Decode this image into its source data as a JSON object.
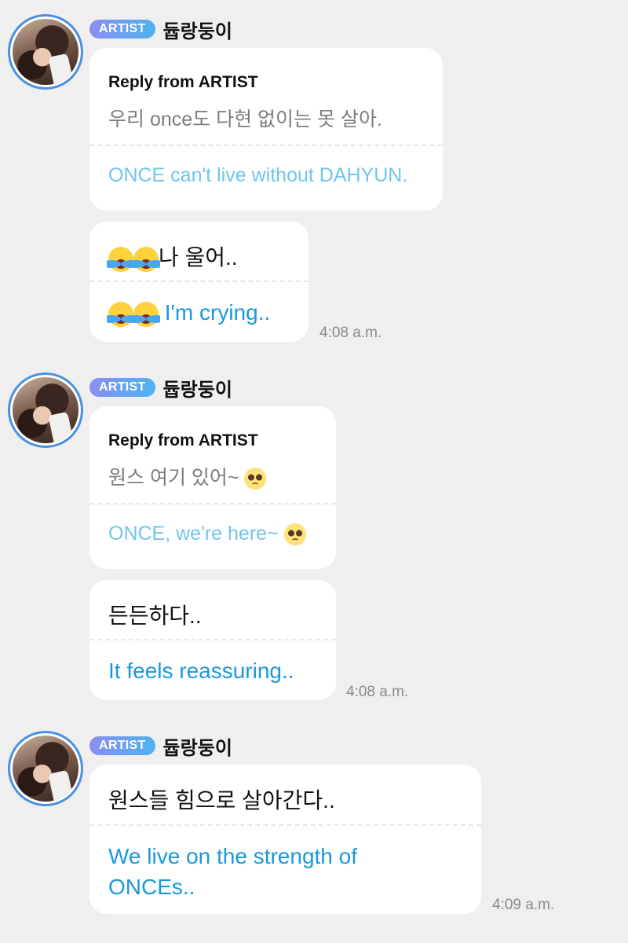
{
  "messages": [
    {
      "badge": "ARTIST",
      "name": "듑랑둥이",
      "reply_label": "Reply from ARTIST",
      "reply_ko": "우리 once도 다현 없이는 못 살아.",
      "reply_en": "ONCE can't live without DAHYUN.",
      "followup_ko": "나 울어..",
      "followup_en": " I'm crying..",
      "time": "4:08 a.m."
    },
    {
      "badge": "ARTIST",
      "name": "듑랑둥이",
      "reply_label": "Reply from ARTIST",
      "reply_ko": "원스 여기 있어~ ",
      "reply_en": "ONCE, we're here~ ",
      "followup_ko": "든든하다..",
      "followup_en": "It feels reassuring..",
      "time": "4:08 a.m."
    },
    {
      "badge": "ARTIST",
      "name": "듑랑둥이",
      "main_ko": "원스들 힘으로 살아간다..",
      "main_en_line1": "We live on the strength of",
      "main_en_line2": "ONCEs..",
      "time": "4:09 a.m."
    }
  ],
  "icons": {
    "crying": "loudly-crying-face-emoji",
    "pleading": "pleading-face-emoji"
  },
  "colors": {
    "background": "#efefef",
    "badge_start": "#8a8ef0",
    "badge_end": "#4fb3ef",
    "translation_blue": "#1a98dc",
    "reply_translation_blue": "#6ec6ec"
  }
}
